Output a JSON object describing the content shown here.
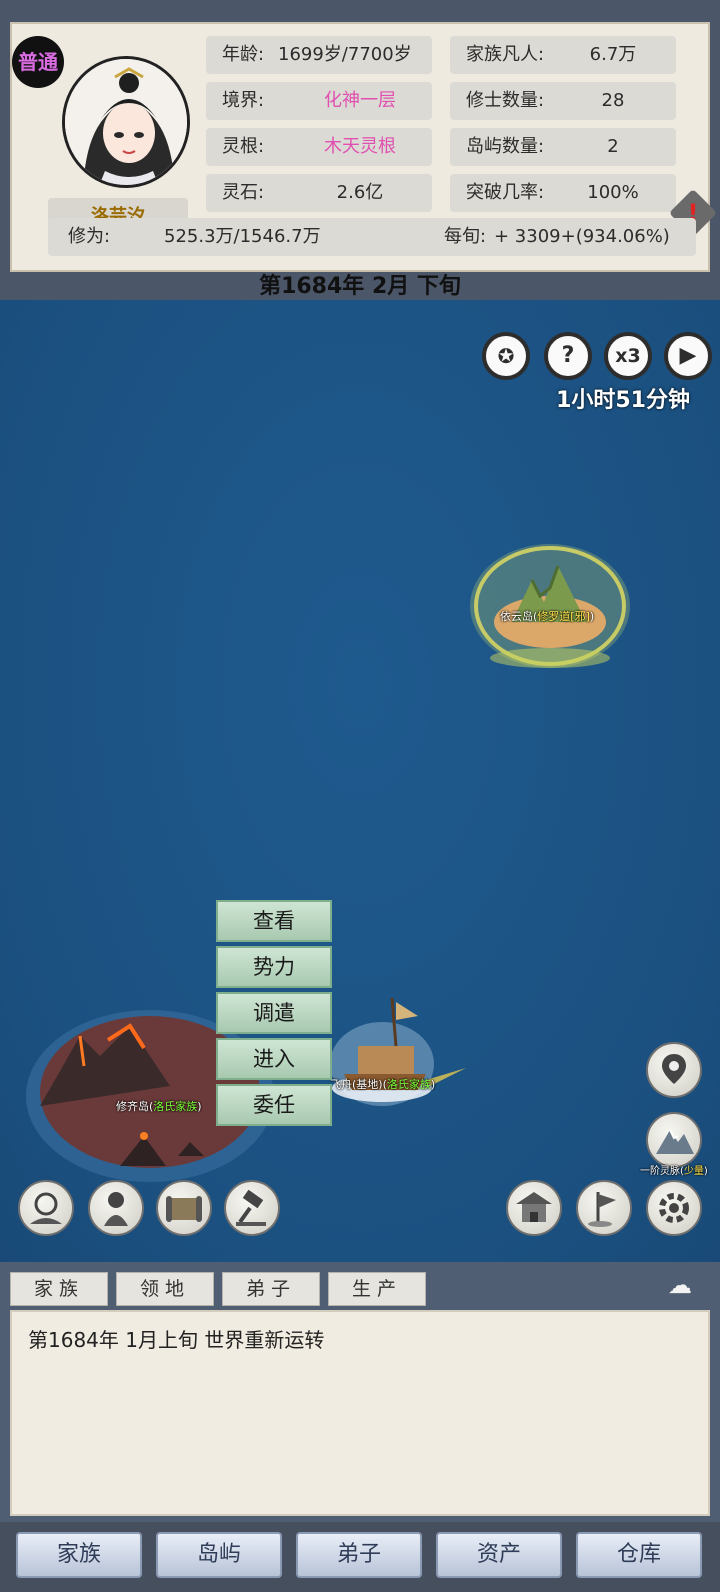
{
  "character": {
    "rank_badge": "普通",
    "name": "洛芸汐",
    "age_label": "年龄:",
    "age_value": "1699岁/7700岁",
    "realm_label": "境界:",
    "realm_value": "化神一层",
    "root_label": "灵根:",
    "root_value": "木天灵根",
    "stone_label": "灵石:",
    "stone_value": "2.6亿",
    "mortals_label": "家族凡人:",
    "mortals_value": "6.7万",
    "cultivators_label": "修士数量:",
    "cultivators_value": "28",
    "islands_label": "岛屿数量:",
    "islands_value": "2",
    "breakthrough_label": "突破几率:",
    "breakthrough_value": "100%",
    "cultivation_label": "修为:",
    "cultivation_value": "525.3万/1546.7万",
    "per_period_label": "每旬:",
    "per_period_value": "+ 3309+(934.06%)"
  },
  "date": "第1684年 2月 下旬",
  "map": {
    "speed_label": "x3",
    "help_label": "?",
    "timer": "1小时51分钟",
    "islands": [
      {
        "name": "依云岛",
        "owner": "修罗道[邪]"
      },
      {
        "name": "修齐岛",
        "owner": "洛氏家族"
      },
      {
        "name": "飞舟(基地)",
        "owner": "洛氏家族"
      },
      {
        "name": "一阶灵脉",
        "owner": "少量"
      }
    ],
    "context_menu": [
      "查看",
      "势力",
      "调遣",
      "进入",
      "委任"
    ]
  },
  "log": {
    "tabs": [
      "家族",
      "领地",
      "弟子",
      "生产"
    ],
    "entries": [
      "第1684年 1月上旬 世界重新运转"
    ]
  },
  "nav": [
    "家族",
    "岛屿",
    "弟子",
    "资产",
    "仓库"
  ],
  "colors": {
    "accent_pink": "#e050b0",
    "owner_green": "#7dff3a",
    "owner_yellow": "#ffe24d",
    "name_gold": "#9a6b00"
  }
}
